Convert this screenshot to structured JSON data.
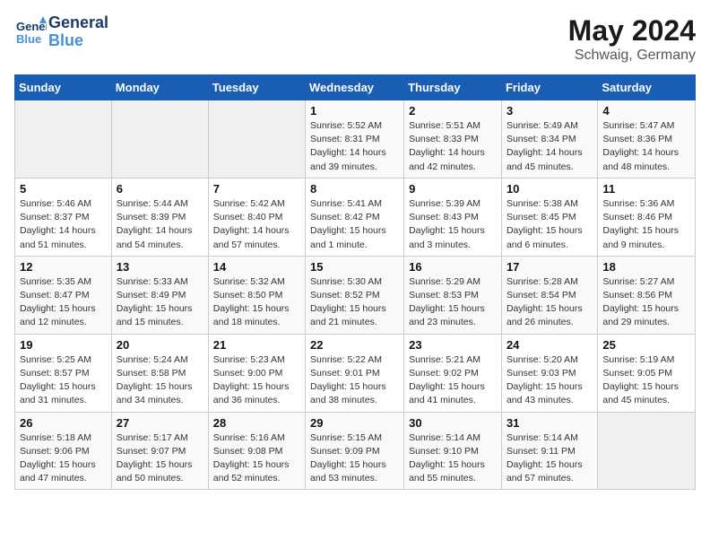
{
  "header": {
    "logo_line1": "General",
    "logo_line2": "Blue",
    "month_year": "May 2024",
    "location": "Schwaig, Germany"
  },
  "days_of_week": [
    "Sunday",
    "Monday",
    "Tuesday",
    "Wednesday",
    "Thursday",
    "Friday",
    "Saturday"
  ],
  "weeks": [
    [
      {
        "day": "",
        "info": ""
      },
      {
        "day": "",
        "info": ""
      },
      {
        "day": "",
        "info": ""
      },
      {
        "day": "1",
        "info": "Sunrise: 5:52 AM\nSunset: 8:31 PM\nDaylight: 14 hours\nand 39 minutes."
      },
      {
        "day": "2",
        "info": "Sunrise: 5:51 AM\nSunset: 8:33 PM\nDaylight: 14 hours\nand 42 minutes."
      },
      {
        "day": "3",
        "info": "Sunrise: 5:49 AM\nSunset: 8:34 PM\nDaylight: 14 hours\nand 45 minutes."
      },
      {
        "day": "4",
        "info": "Sunrise: 5:47 AM\nSunset: 8:36 PM\nDaylight: 14 hours\nand 48 minutes."
      }
    ],
    [
      {
        "day": "5",
        "info": "Sunrise: 5:46 AM\nSunset: 8:37 PM\nDaylight: 14 hours\nand 51 minutes."
      },
      {
        "day": "6",
        "info": "Sunrise: 5:44 AM\nSunset: 8:39 PM\nDaylight: 14 hours\nand 54 minutes."
      },
      {
        "day": "7",
        "info": "Sunrise: 5:42 AM\nSunset: 8:40 PM\nDaylight: 14 hours\nand 57 minutes."
      },
      {
        "day": "8",
        "info": "Sunrise: 5:41 AM\nSunset: 8:42 PM\nDaylight: 15 hours\nand 1 minute."
      },
      {
        "day": "9",
        "info": "Sunrise: 5:39 AM\nSunset: 8:43 PM\nDaylight: 15 hours\nand 3 minutes."
      },
      {
        "day": "10",
        "info": "Sunrise: 5:38 AM\nSunset: 8:45 PM\nDaylight: 15 hours\nand 6 minutes."
      },
      {
        "day": "11",
        "info": "Sunrise: 5:36 AM\nSunset: 8:46 PM\nDaylight: 15 hours\nand 9 minutes."
      }
    ],
    [
      {
        "day": "12",
        "info": "Sunrise: 5:35 AM\nSunset: 8:47 PM\nDaylight: 15 hours\nand 12 minutes."
      },
      {
        "day": "13",
        "info": "Sunrise: 5:33 AM\nSunset: 8:49 PM\nDaylight: 15 hours\nand 15 minutes."
      },
      {
        "day": "14",
        "info": "Sunrise: 5:32 AM\nSunset: 8:50 PM\nDaylight: 15 hours\nand 18 minutes."
      },
      {
        "day": "15",
        "info": "Sunrise: 5:30 AM\nSunset: 8:52 PM\nDaylight: 15 hours\nand 21 minutes."
      },
      {
        "day": "16",
        "info": "Sunrise: 5:29 AM\nSunset: 8:53 PM\nDaylight: 15 hours\nand 23 minutes."
      },
      {
        "day": "17",
        "info": "Sunrise: 5:28 AM\nSunset: 8:54 PM\nDaylight: 15 hours\nand 26 minutes."
      },
      {
        "day": "18",
        "info": "Sunrise: 5:27 AM\nSunset: 8:56 PM\nDaylight: 15 hours\nand 29 minutes."
      }
    ],
    [
      {
        "day": "19",
        "info": "Sunrise: 5:25 AM\nSunset: 8:57 PM\nDaylight: 15 hours\nand 31 minutes."
      },
      {
        "day": "20",
        "info": "Sunrise: 5:24 AM\nSunset: 8:58 PM\nDaylight: 15 hours\nand 34 minutes."
      },
      {
        "day": "21",
        "info": "Sunrise: 5:23 AM\nSunset: 9:00 PM\nDaylight: 15 hours\nand 36 minutes."
      },
      {
        "day": "22",
        "info": "Sunrise: 5:22 AM\nSunset: 9:01 PM\nDaylight: 15 hours\nand 38 minutes."
      },
      {
        "day": "23",
        "info": "Sunrise: 5:21 AM\nSunset: 9:02 PM\nDaylight: 15 hours\nand 41 minutes."
      },
      {
        "day": "24",
        "info": "Sunrise: 5:20 AM\nSunset: 9:03 PM\nDaylight: 15 hours\nand 43 minutes."
      },
      {
        "day": "25",
        "info": "Sunrise: 5:19 AM\nSunset: 9:05 PM\nDaylight: 15 hours\nand 45 minutes."
      }
    ],
    [
      {
        "day": "26",
        "info": "Sunrise: 5:18 AM\nSunset: 9:06 PM\nDaylight: 15 hours\nand 47 minutes."
      },
      {
        "day": "27",
        "info": "Sunrise: 5:17 AM\nSunset: 9:07 PM\nDaylight: 15 hours\nand 50 minutes."
      },
      {
        "day": "28",
        "info": "Sunrise: 5:16 AM\nSunset: 9:08 PM\nDaylight: 15 hours\nand 52 minutes."
      },
      {
        "day": "29",
        "info": "Sunrise: 5:15 AM\nSunset: 9:09 PM\nDaylight: 15 hours\nand 53 minutes."
      },
      {
        "day": "30",
        "info": "Sunrise: 5:14 AM\nSunset: 9:10 PM\nDaylight: 15 hours\nand 55 minutes."
      },
      {
        "day": "31",
        "info": "Sunrise: 5:14 AM\nSunset: 9:11 PM\nDaylight: 15 hours\nand 57 minutes."
      },
      {
        "day": "",
        "info": ""
      }
    ]
  ]
}
